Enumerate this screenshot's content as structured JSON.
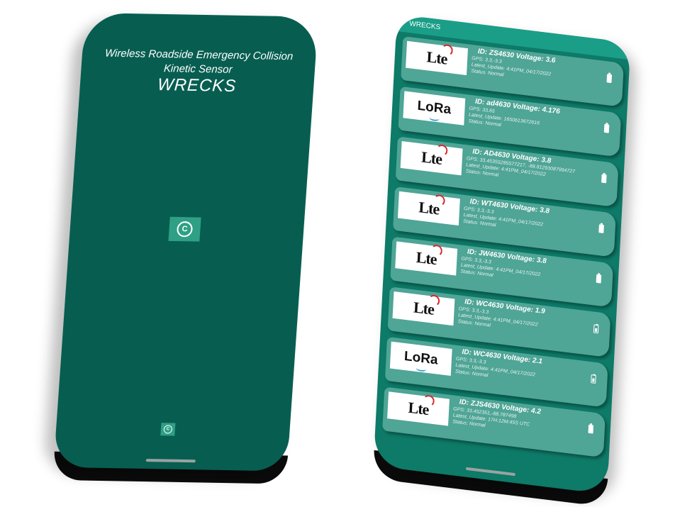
{
  "splash": {
    "line1": "Wireless Roadside Emergency Collision",
    "line2": "Kinetic Sensor",
    "title": "WRECKS",
    "logo_icon": "c-logo-icon"
  },
  "list_screen": {
    "appbar_title": "WRECKS",
    "devices": [
      {
        "type": "Lte",
        "title": "ID: ZS4630  Voltage: 3.6",
        "gps": "GPS: 3.3,-3.3",
        "update": "Latest_Update: 4:41PM_04/17/2022",
        "status": "Status: Normal",
        "battery": "full"
      },
      {
        "type": "LoRa",
        "title": "ID: ad4630  Voltage: 4.176",
        "gps": "GPS: 33.65",
        "update": "Latest_Update: 1650613672616",
        "status": "Status: Normal",
        "battery": "full"
      },
      {
        "type": "Lte",
        "title": "ID: AD4630  Voltage: 3.8",
        "gps": "GPS: 33.45355285577217, -88.81293087994727",
        "update": "Latest_Update: 4:41PM_04/17/2022",
        "status": "Status: Normal",
        "battery": "full"
      },
      {
        "type": "Lte",
        "title": "ID: WT4630  Voltage: 3.8",
        "gps": "GPS: 3.3,-3.3",
        "update": "Latest_Update: 4:41PM_04/17/2022",
        "status": "Status: Normal",
        "battery": "full"
      },
      {
        "type": "Lte",
        "title": "ID: JW4630  Voltage: 3.8",
        "gps": "GPS: 3.3,-3.3",
        "update": "Latest_Update: 4:41PM_04/17/2022",
        "status": "Status: Normal",
        "battery": "full"
      },
      {
        "type": "Lte",
        "title": "ID: WC4630  Voltage: 1.9",
        "gps": "GPS: 3.3,-3.3",
        "update": "Latest_Update: 4:41PM_04/17/2022",
        "status": "Status: Normal",
        "battery": "low"
      },
      {
        "type": "LoRa",
        "title": "ID: WC4630  Voltage: 2.1",
        "gps": "GPS: 3.3,-3.3",
        "update": "Latest_Update: 4:41PM_04/17/2022",
        "status": "Status: Normal",
        "battery": "low"
      },
      {
        "type": "Lte",
        "title": "ID: ZJS4630  Voltage: 4.2",
        "gps": "GPS: 33.452351,-88.787498",
        "update": "Latest_Update: 17H:12M:45S UTC",
        "status": "Status: Normal",
        "battery": "full"
      }
    ]
  },
  "colors": {
    "splash_bg": "#075e50",
    "list_bg": "#0e7a68",
    "card_bg": "#4fa596",
    "appbar_bg": "#1a9e88",
    "logo_bg": "#2f9f85"
  }
}
